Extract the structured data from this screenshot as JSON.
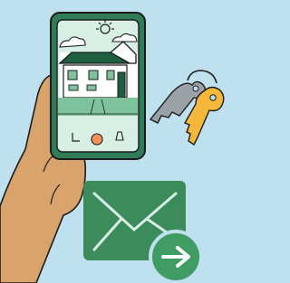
{
  "illustration": {
    "subject": "phone-with-house-keys-and-mail",
    "colors": {
      "background": "#bfe0ef",
      "skin": "#d9a46c",
      "phone_body": "#2f7c56",
      "phone_screen": "#d7efe5",
      "house_roof": "#1f5f41",
      "house_wall": "#ffffff",
      "ground": "#7fc39c",
      "key_gold": "#f6b73a",
      "key_silver": "#9aa1a7",
      "mail_green": "#3b8c5a",
      "arrow_circle": "#3f9c63"
    },
    "icons": [
      "smartphone-icon",
      "house-icon",
      "keys-icon",
      "envelope-icon",
      "arrow-right-icon"
    ]
  }
}
